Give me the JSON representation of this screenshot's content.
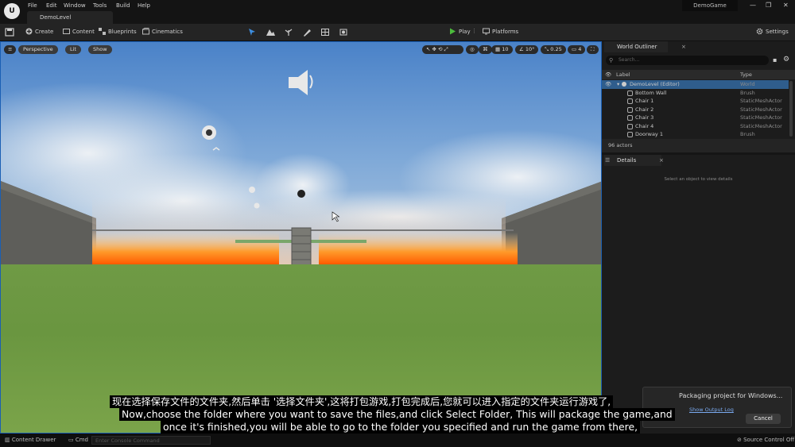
{
  "app": {
    "logo_text": "U",
    "menus": [
      "File",
      "Edit",
      "Window",
      "Tools",
      "Build",
      "Help"
    ],
    "level_tab": "DemoLevel",
    "project_name": "DemoGame",
    "window_controls": [
      "—",
      "❐",
      "✕"
    ]
  },
  "toolbar": {
    "create_label": "Create",
    "content_label": "Content",
    "blueprints_label": "Blueprints",
    "cinematics_label": "Cinematics",
    "play_label": "Play",
    "platforms_label": "Platforms",
    "settings_label": "Settings"
  },
  "viewport": {
    "perspective_label": "Perspective",
    "lit_label": "Lit",
    "show_label": "Show",
    "grid_snap": "10",
    "rotation_snap": "10°",
    "scale_snap": "0.25",
    "camera_speed": "4"
  },
  "outliner": {
    "tab_label": "World Outliner",
    "search_placeholder": "Search...",
    "col_label": "Label",
    "col_type": "Type",
    "root": {
      "label": "DemoLevel (Editor)",
      "type": "World"
    },
    "rows": [
      {
        "label": "Bottom Wall",
        "type": "Brush"
      },
      {
        "label": "Chair 1",
        "type": "StaticMeshActor"
      },
      {
        "label": "Chair 2",
        "type": "StaticMeshActor"
      },
      {
        "label": "Chair 3",
        "type": "StaticMeshActor"
      },
      {
        "label": "Chair 4",
        "type": "StaticMeshActor"
      },
      {
        "label": "Doorway 1",
        "type": "Brush"
      }
    ],
    "actor_count": "96 actors"
  },
  "details": {
    "tab_label": "Details",
    "empty_text": "Select an object to view details"
  },
  "notification": {
    "title": "Packaging project for Windows...",
    "link": "Show Output Log",
    "cancel_label": "Cancel"
  },
  "statusbar": {
    "content_drawer": "Content Drawer",
    "cmd": "Cmd",
    "console_placeholder": "Enter Console Command",
    "source_control": "Source Control Off"
  },
  "subtitles": {
    "line_cn": "现在选择保存文件的文件夹,然后单击 '选择文件夹',这将打包游戏,打包完成后,您就可以进入指定的文件夹运行游戏了,",
    "line_en1": "Now,choose the folder where you want to save the files,and click Select Folder, This will package the game,and",
    "line_en2": "once it's finished,you will be able to go to the folder you specified and run the game from there,"
  }
}
